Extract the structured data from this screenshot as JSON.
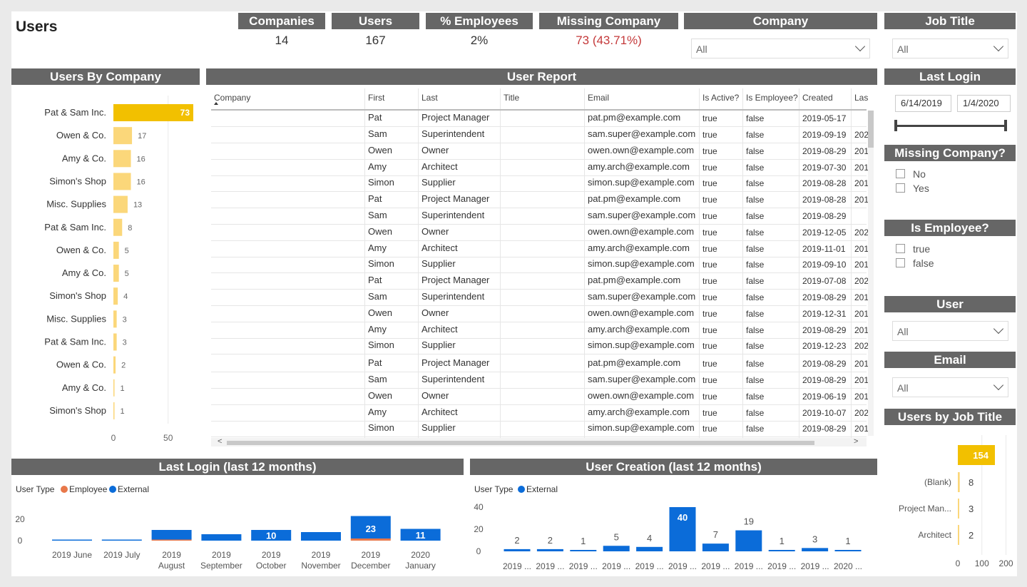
{
  "page": {
    "title": "Users"
  },
  "kpis": {
    "companies": {
      "label": "Companies",
      "value": "14"
    },
    "users": {
      "label": "Users",
      "value": "167"
    },
    "employees": {
      "label": "% Employees",
      "value": "2%"
    },
    "missing": {
      "label": "Missing Company",
      "value": "73 (43.71%)"
    }
  },
  "filters": {
    "company": {
      "label": "Company",
      "value": "All"
    },
    "job_title": {
      "label": "Job Title",
      "value": "All"
    },
    "last_login": {
      "label": "Last Login",
      "start": "6/14/2019",
      "end": "1/4/2020"
    },
    "missing_company": {
      "label": "Missing Company?",
      "options": [
        "No",
        "Yes"
      ]
    },
    "is_employee": {
      "label": "Is Employee?",
      "options": [
        "true",
        "false"
      ]
    },
    "user": {
      "label": "User",
      "value": "All"
    },
    "email": {
      "label": "Email",
      "value": "All"
    }
  },
  "report": {
    "title": "User Report",
    "columns": [
      "Company",
      "First",
      "Last",
      "Title",
      "Email",
      "Is Active?",
      "Is Employee?",
      "Created",
      "Las"
    ],
    "rows": [
      [
        "",
        "Pat",
        "Project Manager",
        "",
        "pat.pm@example.com",
        "true",
        "false",
        "2019-05-17",
        ""
      ],
      [
        "",
        "Sam",
        "Superintendent",
        "",
        "sam.super@example.com",
        "true",
        "false",
        "2019-09-19",
        "202"
      ],
      [
        "",
        "Owen",
        "Owner",
        "",
        "owen.own@example.com",
        "true",
        "false",
        "2019-08-29",
        "201"
      ],
      [
        "",
        "Amy",
        "Architect",
        "",
        "amy.arch@example.com",
        "true",
        "false",
        "2019-07-30",
        "201"
      ],
      [
        "",
        "Simon",
        "Supplier",
        "",
        "simon.sup@example.com",
        "true",
        "false",
        "2019-08-28",
        "201"
      ],
      [
        "",
        "Pat",
        "Project Manager",
        "",
        "pat.pm@example.com",
        "true",
        "false",
        "2019-08-28",
        "201"
      ],
      [
        "",
        "Sam",
        "Superintendent",
        "",
        "sam.super@example.com",
        "true",
        "false",
        "2019-08-29",
        ""
      ],
      [
        "",
        "Owen",
        "Owner",
        "",
        "owen.own@example.com",
        "true",
        "false",
        "2019-12-05",
        "202"
      ],
      [
        "",
        "Amy",
        "Architect",
        "",
        "amy.arch@example.com",
        "true",
        "false",
        "2019-11-01",
        "201"
      ],
      [
        "",
        "Simon",
        "Supplier",
        "",
        "simon.sup@example.com",
        "true",
        "false",
        "2019-09-10",
        "201"
      ],
      [
        "",
        "Pat",
        "Project Manager",
        "",
        "pat.pm@example.com",
        "true",
        "false",
        "2019-07-08",
        "202"
      ],
      [
        "",
        "Sam",
        "Superintendent",
        "",
        "sam.super@example.com",
        "true",
        "false",
        "2019-08-29",
        "201"
      ],
      [
        "",
        "Owen",
        "Owner",
        "",
        "owen.own@example.com",
        "true",
        "false",
        "2019-12-31",
        "201"
      ],
      [
        "",
        "Amy",
        "Architect",
        "",
        "amy.arch@example.com",
        "true",
        "false",
        "2019-08-29",
        "201"
      ],
      [
        "",
        "Simon",
        "Supplier",
        "",
        "simon.sup@example.com",
        "true",
        "false",
        "2019-12-23",
        "202"
      ],
      [
        "",
        "Pat",
        "Project Manager",
        "",
        "pat.pm@example.com",
        "true",
        "false",
        "2019-08-29",
        "201"
      ],
      [
        "",
        "Sam",
        "Superintendent",
        "",
        "sam.super@example.com",
        "true",
        "false",
        "2019-08-29",
        "201"
      ],
      [
        "",
        "Owen",
        "Owner",
        "",
        "owen.own@example.com",
        "true",
        "false",
        "2019-06-19",
        "201"
      ],
      [
        "",
        "Amy",
        "Architect",
        "",
        "amy.arch@example.com",
        "true",
        "false",
        "2019-10-07",
        "202"
      ],
      [
        "",
        "Simon",
        "Supplier",
        "",
        "simon.sup@example.com",
        "true",
        "false",
        "2019-08-29",
        "201"
      ]
    ]
  },
  "chart_data": [
    {
      "id": "users_by_company",
      "type": "bar",
      "orientation": "horizontal",
      "title": "Users By Company",
      "categories": [
        "Pat & Sam Inc.",
        "Owen & Co.",
        "Amy & Co.",
        "Simon's Shop",
        "Misc. Supplies",
        "Pat & Sam Inc.",
        "Owen & Co.",
        "Amy & Co.",
        "Simon's Shop",
        "Misc. Supplies",
        "Pat & Sam Inc.",
        "Owen & Co.",
        "Amy & Co.",
        "Simon's Shop"
      ],
      "values": [
        73,
        17,
        16,
        16,
        13,
        8,
        5,
        5,
        4,
        3,
        3,
        2,
        1,
        1
      ],
      "xticks": [
        0,
        50
      ],
      "xlim": [
        0,
        80
      ],
      "colors": {
        "highlight": "#f2c000",
        "normal": "#fbd77a"
      }
    },
    {
      "id": "last_login",
      "type": "bar",
      "stacked": true,
      "title": "Last Login (last 12 months)",
      "legend_title": "User Type",
      "categories": [
        [
          "2019 June"
        ],
        [
          "2019 July"
        ],
        [
          "2019",
          "August"
        ],
        [
          "2019",
          "September"
        ],
        [
          "2019",
          "October"
        ],
        [
          "2019",
          "November"
        ],
        [
          "2019",
          "December"
        ],
        [
          "2020",
          "January"
        ]
      ],
      "series": [
        {
          "name": "Employee",
          "color": "#e8784a",
          "values": [
            0,
            0,
            1,
            0,
            0,
            0,
            2,
            0
          ]
        },
        {
          "name": "External",
          "color": "#0b6cd9",
          "values": [
            1,
            1,
            9,
            6,
            10,
            8,
            21,
            11
          ]
        }
      ],
      "data_labels": [
        "",
        "",
        "",
        "",
        "10",
        "",
        "23",
        "11"
      ],
      "yticks": [
        0,
        20
      ],
      "ylim": [
        0,
        25
      ]
    },
    {
      "id": "user_creation",
      "type": "bar",
      "title": "User Creation (last 12 months)",
      "legend_title": "User Type",
      "categories": [
        "2019 ...",
        "2019 ...",
        "2019 ...",
        "2019 ...",
        "2019 ...",
        "2019 ...",
        "2019 ...",
        "2019 ...",
        "2019 ...",
        "2019 ...",
        "2020 ..."
      ],
      "series": [
        {
          "name": "External",
          "color": "#0b6cd9",
          "values": [
            2,
            2,
            1,
            5,
            4,
            40,
            7,
            19,
            1,
            3,
            1
          ]
        }
      ],
      "yticks": [
        0,
        20,
        40
      ],
      "ylim": [
        0,
        40
      ]
    },
    {
      "id": "users_by_job_title",
      "type": "bar",
      "orientation": "horizontal",
      "title": "Users by Job Title",
      "categories": [
        "",
        "(Blank)",
        "Project Man...",
        "Architect"
      ],
      "values": [
        154,
        8,
        3,
        2
      ],
      "xticks": [
        0,
        100,
        200
      ],
      "xlim": [
        0,
        230
      ],
      "colors": {
        "highlight": "#f2c000",
        "normal": "#fbd77a"
      }
    }
  ]
}
